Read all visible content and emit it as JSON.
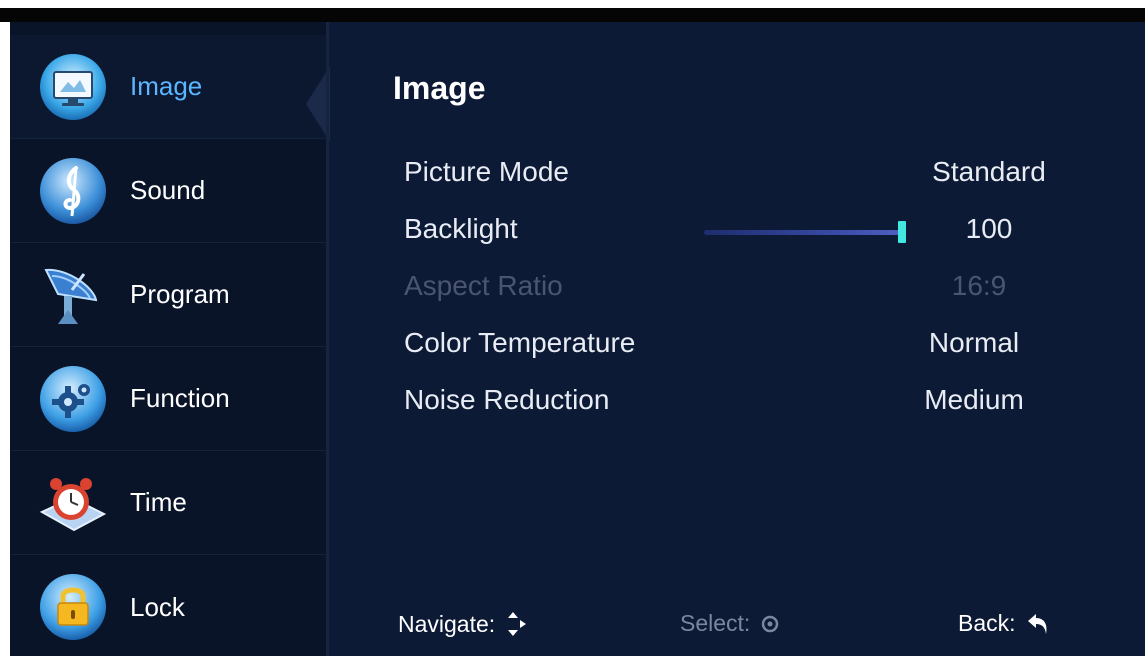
{
  "sidebar": {
    "items": [
      {
        "label": "Image",
        "icon": "monitor-icon",
        "active": true
      },
      {
        "label": "Sound",
        "icon": "music-note-icon",
        "active": false
      },
      {
        "label": "Program",
        "icon": "satellite-dish-icon",
        "active": false
      },
      {
        "label": "Function",
        "icon": "gear-icon",
        "active": false
      },
      {
        "label": "Time",
        "icon": "alarm-clock-icon",
        "active": false
      },
      {
        "label": "Lock",
        "icon": "padlock-icon",
        "active": false
      }
    ]
  },
  "main": {
    "title": "Image",
    "settings": [
      {
        "name": "Picture Mode",
        "value": "Standard",
        "enabled": true
      },
      {
        "name": "Backlight",
        "value": "100",
        "enabled": true,
        "slider_level": 1.0
      },
      {
        "name": "Aspect Ratio",
        "value": "16:9",
        "enabled": false
      },
      {
        "name": "Color Temperature",
        "value": "Normal",
        "enabled": true
      },
      {
        "name": "Noise Reduction",
        "value": "Medium",
        "enabled": true
      }
    ]
  },
  "footer": {
    "navigate_label": "Navigate:",
    "select_label": "Select:",
    "back_label": "Back:"
  },
  "colors": {
    "background": "#0d1a35",
    "sidebar": "#0a1428",
    "active_label": "#5ab6ff",
    "slider_thumb": "#40e8e0",
    "disabled_text": "#4a5670"
  }
}
